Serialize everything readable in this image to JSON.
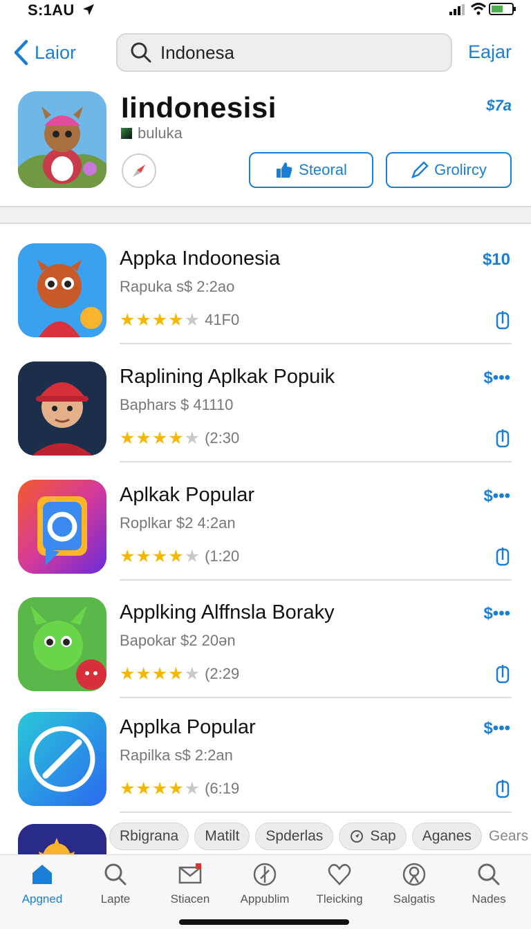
{
  "status_bar": {
    "time": "S:1AU"
  },
  "nav": {
    "back_label": "Laior",
    "search_value": "Indonesa",
    "right_label": "Eajar"
  },
  "hero": {
    "title": "Iindonesisi",
    "subtitle": "buluka",
    "price": "$7a",
    "button_primary": "Steoral",
    "button_secondary": "Grolircy"
  },
  "apps": [
    {
      "name": "Appka Indoonesia",
      "meta": "Rapuka s$ 2:2ao",
      "stars": 4,
      "count": "41F0",
      "price": "$10"
    },
    {
      "name": "Raplining Aplkak Popuik",
      "meta": "Baphars $ 41110",
      "stars": 4,
      "count": "(2:30",
      "price": "$•••"
    },
    {
      "name": "Aplkak Popular",
      "meta": "Roplkar $2 4:2an",
      "stars": 4,
      "count": "(1:20",
      "price": "$•••"
    },
    {
      "name": "Applking Alffnsla Boraky",
      "meta": "Bapokar $2 20ǝn",
      "stars": 4,
      "count": "(2:29",
      "price": "$•••"
    },
    {
      "name": "Applka Popular",
      "meta": "Rapilka s$ 2:2an",
      "stars": 4,
      "count": "(6:19",
      "price": "$•••"
    }
  ],
  "chips": [
    "Rbigrana",
    "Matilt",
    "Spderlas",
    "Sap",
    "Aganes",
    "Gears"
  ],
  "tabs": [
    {
      "label": "Apgned",
      "icon": "home-icon",
      "active": true
    },
    {
      "label": "Lapte",
      "icon": "search-icon"
    },
    {
      "label": "Stiacen",
      "icon": "mail-icon"
    },
    {
      "label": "Appublim",
      "icon": "compass-icon"
    },
    {
      "label": "Tleicking",
      "icon": "heart-icon"
    },
    {
      "label": "Salgatis",
      "icon": "badge-icon"
    },
    {
      "label": "Nades",
      "icon": "search-icon"
    }
  ],
  "colors": {
    "accent": "#1a7fd4",
    "star": "#f5b800"
  }
}
